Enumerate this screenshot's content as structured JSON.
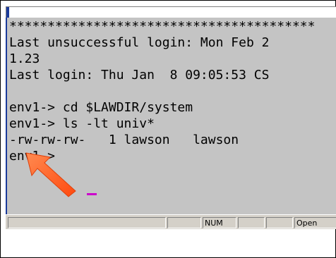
{
  "terminal": {
    "lines": [
      "****************************************",
      "Last unsuccessful login: Mon Feb 2",
      "1.23",
      "Last login: Thu Jan  8 09:05:53 CS",
      "",
      "env1-> cd $LAWDIR/system",
      "env1-> ls -lt univ*",
      "-rw-rw-rw-   1 lawson   lawson",
      "env1->"
    ]
  },
  "statusbar": {
    "panel_1": "",
    "panel_2": "",
    "num": "NUM",
    "panel_4": "",
    "panel_5": "",
    "open": "Open"
  },
  "colors": {
    "terminal_bg": "#c4c4c4",
    "cursor": "#cc00cc",
    "arrow": "#ff5a1e"
  },
  "icons": {
    "pointer": "orange-arrow-icon"
  }
}
